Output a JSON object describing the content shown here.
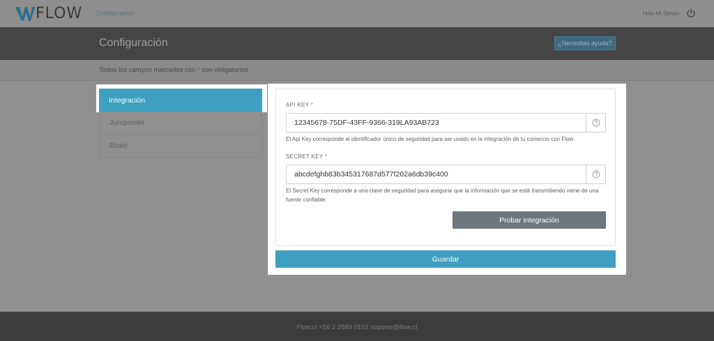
{
  "header": {
    "logo_text": "FLOW",
    "breadcrumb": "Configuración",
    "user_greeting": "Hola Mi Senda",
    "power_icon": "power-icon"
  },
  "hero": {
    "title": "Configuración",
    "help_button": "¿Necesitas ayuda?"
  },
  "subbar": {
    "note_prefix": "Todos los campos marcados con",
    "note_star": "*",
    "note_suffix": "son obligatorios"
  },
  "sidebar": {
    "items": [
      {
        "label": "Integración",
        "active": true
      },
      {
        "label": "Jumpseller",
        "active": false
      },
      {
        "label": "Bsale",
        "active": false
      }
    ]
  },
  "form": {
    "api_key": {
      "label": "API KEY",
      "star": "*",
      "value": "12345678-75DF-43FF-9366-319LA93AB723",
      "help": "El Api Key corresponde al identificador único de seguridad para ser usado en la integración de tu comercio con Flow."
    },
    "secret_key": {
      "label": "SECRET KEY",
      "star": "*",
      "value": "abcdefghb83b345317687d577f202a6db39c400",
      "help": "El Secret Key corresponde a una clave de seguridad para asegurar que la información que se está transmitiendo viene de una fuente confiable."
    },
    "test_button": "Probar integración",
    "save_button": "Guardar"
  },
  "footer": {
    "text": "Flow.cl +56 2 2583 0102 soporte@flow.cl"
  },
  "colors": {
    "accent": "#3f9fc0",
    "test_button": "#6e757d",
    "footer": "#3c3c3c"
  }
}
